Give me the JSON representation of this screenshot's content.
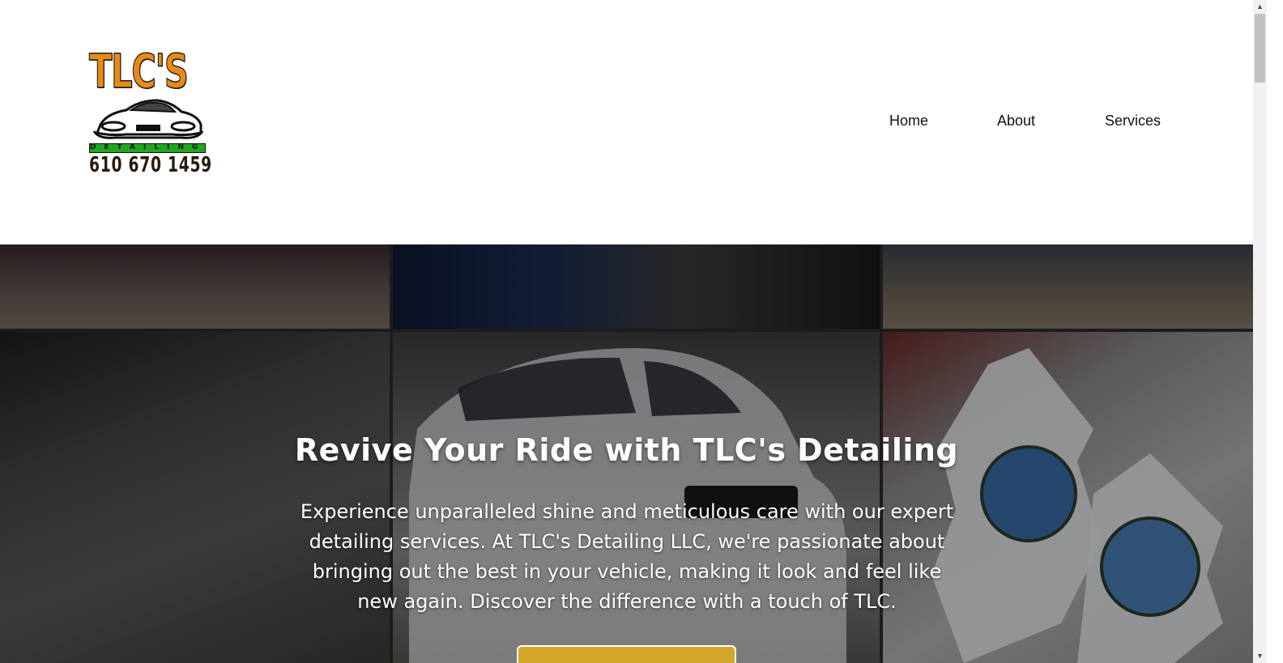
{
  "brand": {
    "logo_title": "TLC'S",
    "logo_subtitle": "DETAILING",
    "logo_phone": "610 670 1459"
  },
  "nav": {
    "items": [
      {
        "label": "Home"
      },
      {
        "label": "About"
      },
      {
        "label": "Services"
      }
    ]
  },
  "hero": {
    "title": "Revive Your Ride with TLC's Detailing",
    "text": "Experience unparalleled shine and meticulous care with our expert detailing services. At TLC's Detailing LLC, we're passionate about bringing out the best in your vehicle, making it look and feel like new again. Discover the difference with a touch of TLC."
  },
  "colors": {
    "brand_orange": "#e98a17",
    "brand_green": "#1fa81f",
    "cta_gold": "#d4a62a"
  }
}
